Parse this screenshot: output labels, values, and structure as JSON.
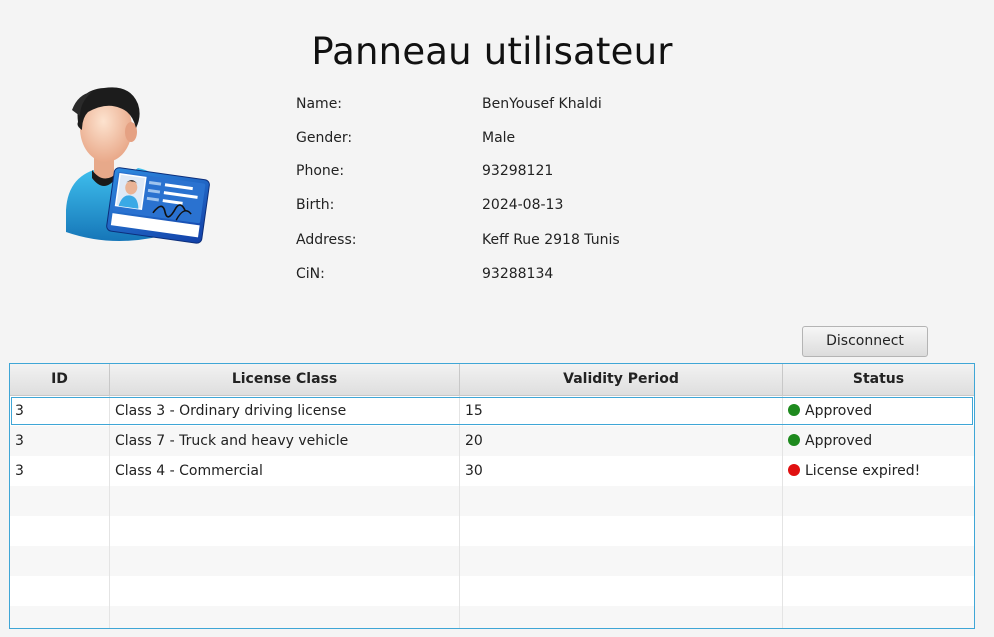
{
  "page": {
    "title": "Panneau utilisateur"
  },
  "profile": {
    "fields": [
      {
        "label": "Name:",
        "value": "BenYousef Khaldi"
      },
      {
        "label": "Gender:",
        "value": "Male"
      },
      {
        "label": "Phone:",
        "value": "93298121"
      },
      {
        "label": "Birth:",
        "value": "2024-08-13"
      },
      {
        "label": "Address:",
        "value": "Keff Rue 2918 Tunis"
      },
      {
        "label": "CiN:",
        "value": "93288134"
      }
    ],
    "avatar_icon": "user-with-id-card-icon"
  },
  "actions": {
    "disconnect_label": "Disconnect"
  },
  "table": {
    "columns": [
      "ID",
      "License Class",
      "Validity Period",
      "Status"
    ],
    "rows": [
      {
        "id": "3",
        "license_class": "Class 3 - Ordinary driving license",
        "validity": "15",
        "status": "Approved",
        "status_color": "#1e8a1e",
        "status_icon": "status-dot-icon"
      },
      {
        "id": "3",
        "license_class": "Class 7 - Truck and heavy vehicle",
        "validity": "20",
        "status": "Approved",
        "status_color": "#1e8a1e",
        "status_icon": "status-dot-icon"
      },
      {
        "id": "3",
        "license_class": "Class 4 - Commercial",
        "validity": "30",
        "status": "License expired!",
        "status_color": "#e01010",
        "status_icon": "status-dot-icon"
      }
    ],
    "selected_row": 0,
    "empty_rows": 5
  },
  "colors": {
    "accent": "#3fa6d6",
    "approved": "#1e8a1e",
    "expired": "#e01010"
  }
}
